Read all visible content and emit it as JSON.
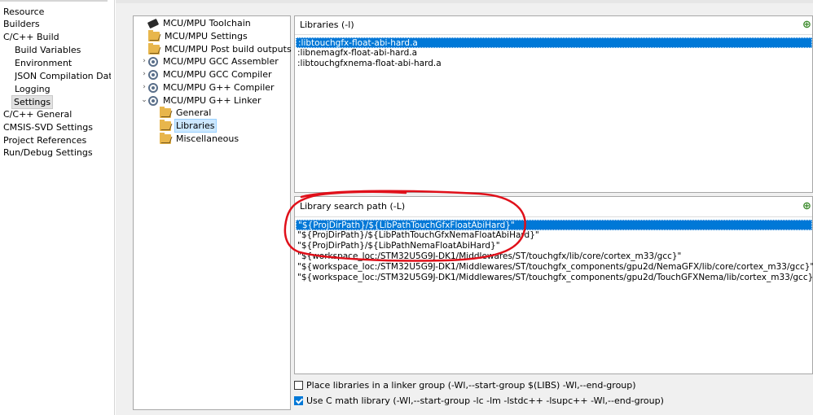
{
  "left_nav": {
    "items": [
      {
        "label": "Resource",
        "indent": 0
      },
      {
        "label": "Builders",
        "indent": 0
      },
      {
        "label": "C/C++ Build",
        "indent": 0
      },
      {
        "label": "Build Variables",
        "indent": 1
      },
      {
        "label": "Environment",
        "indent": 1
      },
      {
        "label": "JSON Compilation Datab",
        "indent": 1
      },
      {
        "label": "Logging",
        "indent": 1
      },
      {
        "label": "Settings",
        "indent": 1,
        "selected": true
      },
      {
        "label": "C/C++ General",
        "indent": 0
      },
      {
        "label": "CMSIS-SVD Settings",
        "indent": 0
      },
      {
        "label": "Project References",
        "indent": 0
      },
      {
        "label": "Run/Debug Settings",
        "indent": 0
      }
    ]
  },
  "tool_tree": {
    "items": [
      {
        "label": "MCU/MPU Toolchain",
        "icon": "toolchain-icon",
        "chevron": ""
      },
      {
        "label": "MCU/MPU Settings",
        "icon": "folder-icon",
        "chevron": ""
      },
      {
        "label": "MCU/MPU Post build outputs",
        "icon": "folder-icon",
        "chevron": ""
      },
      {
        "label": "MCU/MPU GCC Assembler",
        "icon": "gear-icon",
        "chevron": "›"
      },
      {
        "label": "MCU/MPU GCC Compiler",
        "icon": "gear-icon",
        "chevron": "›"
      },
      {
        "label": "MCU/MPU G++ Compiler",
        "icon": "gear-icon",
        "chevron": "›"
      },
      {
        "label": "MCU/MPU G++ Linker",
        "icon": "gear-icon",
        "chevron": "⌄"
      },
      {
        "label": "General",
        "icon": "folder-icon",
        "chevron": "",
        "child": true
      },
      {
        "label": "Libraries",
        "icon": "folder-icon",
        "chevron": "",
        "child": true,
        "selected": true
      },
      {
        "label": "Miscellaneous",
        "icon": "folder-icon",
        "chevron": "",
        "child": true
      }
    ]
  },
  "libraries": {
    "title": "Libraries (-l)",
    "items": [
      {
        "label": ":libtouchgfx-float-abi-hard.a",
        "selected": true
      },
      {
        "label": ":libnemagfx-float-abi-hard.a"
      },
      {
        "label": ":libtouchgfxnema-float-abi-hard.a"
      }
    ]
  },
  "search_path": {
    "title": "Library search path (-L)",
    "items": [
      {
        "label": "\"${ProjDirPath}/${LibPathTouchGfxFloatAbiHard}\"",
        "selected": true
      },
      {
        "label": "\"${ProjDirPath}/${LibPathTouchGfxNemaFloatAbiHard}\""
      },
      {
        "label": "\"${ProjDirPath}/${LibPathNemaFloatAbiHard}\""
      },
      {
        "label": "\"${workspace_loc:/STM32U5G9J-DK1/Middlewares/ST/touchgfx/lib/core/cortex_m33/gcc}\""
      },
      {
        "label": "\"${workspace_loc:/STM32U5G9J-DK1/Middlewares/ST/touchgfx_components/gpu2d/NemaGFX/lib/core/cortex_m33/gcc}\""
      },
      {
        "label": "\"${workspace_loc:/STM32U5G9J-DK1/Middlewares/ST/touchgfx_components/gpu2d/TouchGFXNema/lib/cortex_m33/gcc}\""
      }
    ]
  },
  "options": {
    "linker_group": {
      "label": "Place libraries in a linker group (-Wl,--start-group $(LIBS) -Wl,--end-group)",
      "checked": false
    },
    "c_math": {
      "label": "Use C math library (-Wl,--start-group -lc -lm -lstdc++ -lsupc++ -Wl,--end-group)",
      "checked": true
    }
  },
  "colors": {
    "selection": "#0078d7",
    "annotation": "#e0101a",
    "add_icon": "#3a8a2a"
  }
}
